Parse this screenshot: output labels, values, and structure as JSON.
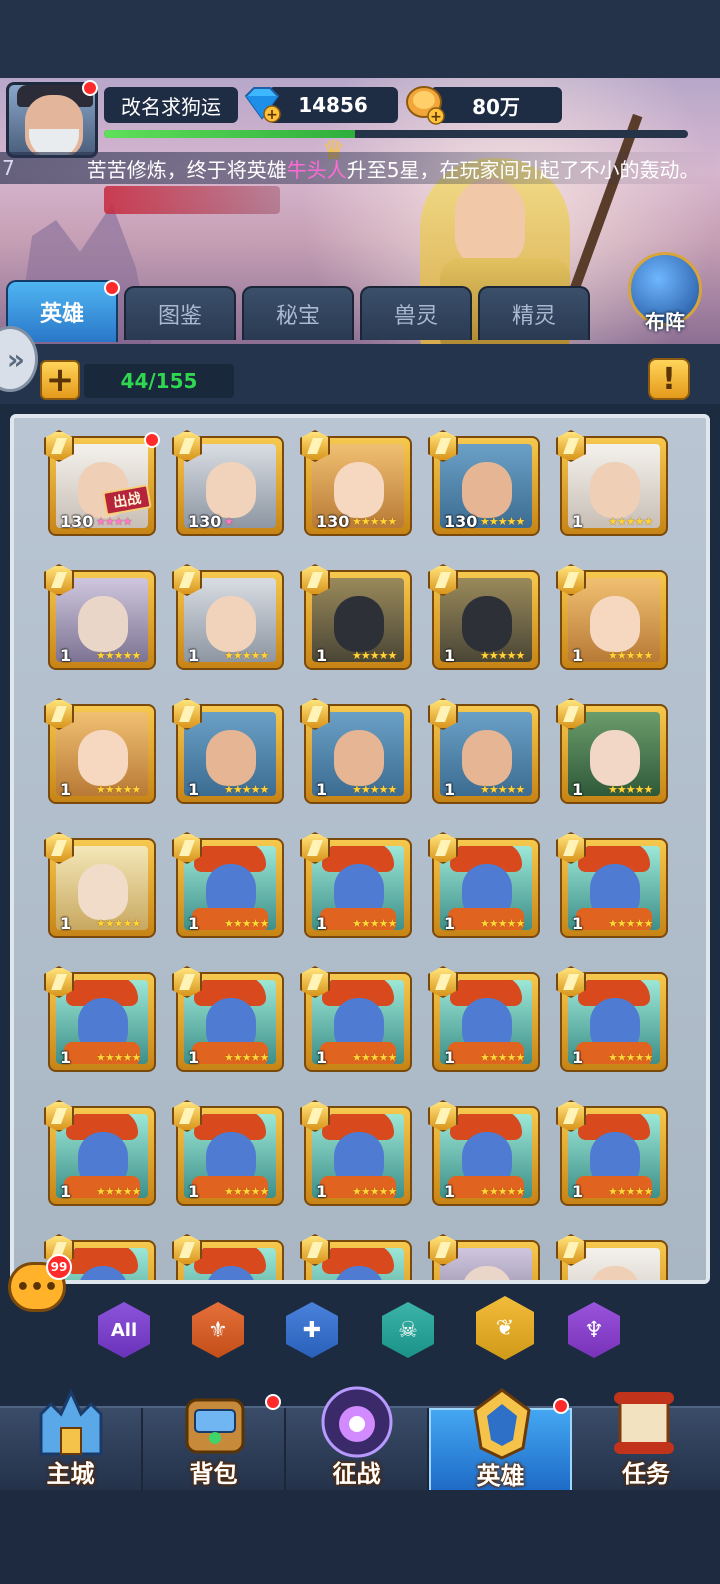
{
  "player": {
    "name": "改名求狗运",
    "diamonds": "14856",
    "gold": "80万",
    "exp_fraction": 0.43
  },
  "marquee": {
    "prefix": "7",
    "text_a": "苦苦修炼，终于将英雄",
    "hero": "牛头人",
    "text_b": "升至5星，在玩家间引起了不小的轰动。"
  },
  "tabs": [
    {
      "label": "英雄",
      "active": true
    },
    {
      "label": "图鉴"
    },
    {
      "label": "秘宝"
    },
    {
      "label": "兽灵"
    },
    {
      "label": "精灵"
    }
  ],
  "deploy_label": "布阵",
  "hero_count": "44/155",
  "excl_label": "!",
  "plus_label": "+",
  "heroes": [
    {
      "level": "130",
      "portrait": "white",
      "stars": "★★★★",
      "pink": true,
      "deployed_label": "出战",
      "red_dot": true
    },
    {
      "level": "130",
      "portrait": "silver",
      "stars": "★",
      "pink": true
    },
    {
      "level": "130",
      "portrait": "blonde",
      "stars": "★★★★★"
    },
    {
      "level": "130",
      "portrait": "elf",
      "stars": "★★★★★"
    },
    {
      "level": "1",
      "portrait": "white",
      "stars": "★★★★★"
    },
    {
      "level": "1",
      "portrait": "sage",
      "stars": "★★★★★"
    },
    {
      "level": "1",
      "portrait": "silver",
      "stars": "★★★★★"
    },
    {
      "level": "1",
      "portrait": "hood",
      "stars": "★★★★★"
    },
    {
      "level": "1",
      "portrait": "hood",
      "stars": "★★★★★"
    },
    {
      "level": "1",
      "portrait": "blonde",
      "stars": "★★★★★"
    },
    {
      "level": "1",
      "portrait": "blonde",
      "stars": "★★★★★"
    },
    {
      "level": "1",
      "portrait": "elf",
      "stars": "★★★★★"
    },
    {
      "level": "1",
      "portrait": "elf",
      "stars": "★★★★★"
    },
    {
      "level": "1",
      "portrait": "elf",
      "stars": "★★★★★"
    },
    {
      "level": "1",
      "portrait": "ghost",
      "stars": "★★★★★"
    },
    {
      "level": "1",
      "portrait": "gold",
      "stars": "★★★★★"
    },
    {
      "level": "1",
      "portrait": "troll",
      "stars": "★★★★★"
    },
    {
      "level": "1",
      "portrait": "troll",
      "stars": "★★★★★"
    },
    {
      "level": "1",
      "portrait": "troll",
      "stars": "★★★★★"
    },
    {
      "level": "1",
      "portrait": "troll",
      "stars": "★★★★★"
    },
    {
      "level": "1",
      "portrait": "troll",
      "stars": "★★★★★"
    },
    {
      "level": "1",
      "portrait": "troll",
      "stars": "★★★★★"
    },
    {
      "level": "1",
      "portrait": "troll",
      "stars": "★★★★★"
    },
    {
      "level": "1",
      "portrait": "troll",
      "stars": "★★★★★"
    },
    {
      "level": "1",
      "portrait": "troll",
      "stars": "★★★★★"
    },
    {
      "level": "1",
      "portrait": "troll",
      "stars": "★★★★★"
    },
    {
      "level": "1",
      "portrait": "troll",
      "stars": "★★★★★"
    },
    {
      "level": "1",
      "portrait": "troll",
      "stars": "★★★★★"
    },
    {
      "level": "1",
      "portrait": "troll",
      "stars": "★★★★★"
    },
    {
      "level": "1",
      "portrait": "troll",
      "stars": "★★★★★"
    },
    {
      "level": "",
      "portrait": "troll",
      "stars": ""
    },
    {
      "level": "",
      "portrait": "troll",
      "stars": ""
    },
    {
      "level": "",
      "portrait": "troll",
      "stars": ""
    },
    {
      "level": "",
      "portrait": "sage",
      "stars": ""
    },
    {
      "level": "",
      "portrait": "white",
      "stars": ""
    }
  ],
  "filters": [
    {
      "name": "all",
      "label": "All",
      "color": "#7a3ad6"
    },
    {
      "name": "warrior",
      "label": "",
      "color": "#e25a1c"
    },
    {
      "name": "mage",
      "label": "",
      "color": "#2f6fd6"
    },
    {
      "name": "assassin",
      "label": "",
      "color": "#1ea89c"
    },
    {
      "name": "support",
      "label": "",
      "color": "#f0b21c"
    },
    {
      "name": "tank",
      "label": "",
      "color": "#8a3ad6"
    }
  ],
  "chat_badge": "99",
  "nav": [
    {
      "label": "主城",
      "icon": "castle-icon"
    },
    {
      "label": "背包",
      "icon": "backpack-icon",
      "red_dot": true
    },
    {
      "label": "征战",
      "icon": "dragon-portal-icon"
    },
    {
      "label": "英雄",
      "icon": "hero-helmet-icon",
      "active": true,
      "red_dot": true
    },
    {
      "label": "任务",
      "icon": "scroll-icon"
    }
  ]
}
